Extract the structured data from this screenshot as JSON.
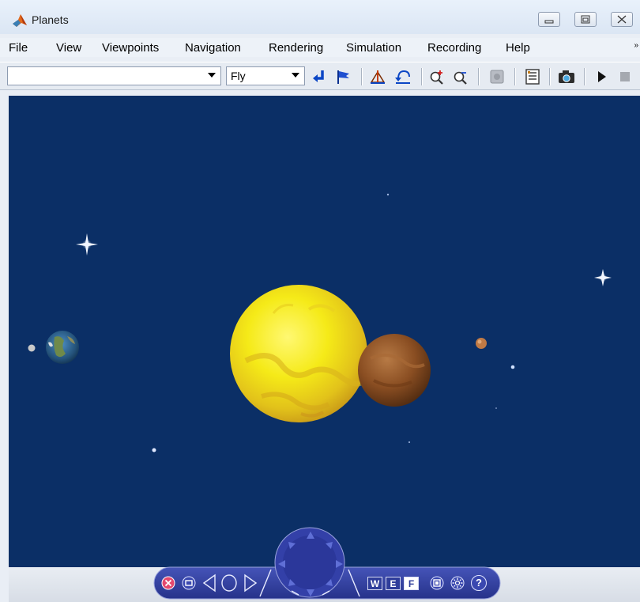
{
  "window": {
    "title": "Planets"
  },
  "menu": {
    "items": [
      "File",
      "View",
      "Viewpoints",
      "Navigation",
      "Rendering",
      "Simulation",
      "Recording",
      "Help"
    ],
    "overflow_glyph": "»"
  },
  "toolbar": {
    "viewpoint_value": "",
    "navigation_mode": "Fly",
    "buttons": [
      "return-viewpoint-icon",
      "create-viewpoint-icon",
      "straighten-icon",
      "go-to-default-icon",
      "zoom-in-icon",
      "zoom-out-icon",
      "headlight-icon",
      "properties-icon",
      "snapshot-icon",
      "start-simulation-icon",
      "stop-simulation-icon"
    ]
  },
  "nav_panel": {
    "wireframe_label": "W",
    "edges_label": "E",
    "faces_label": "F",
    "help_label": "?"
  },
  "colors": {
    "space": "#0b2f66",
    "sun": "#f4e614",
    "venus": "#8a4e22",
    "panel": "#2f3d9a"
  }
}
